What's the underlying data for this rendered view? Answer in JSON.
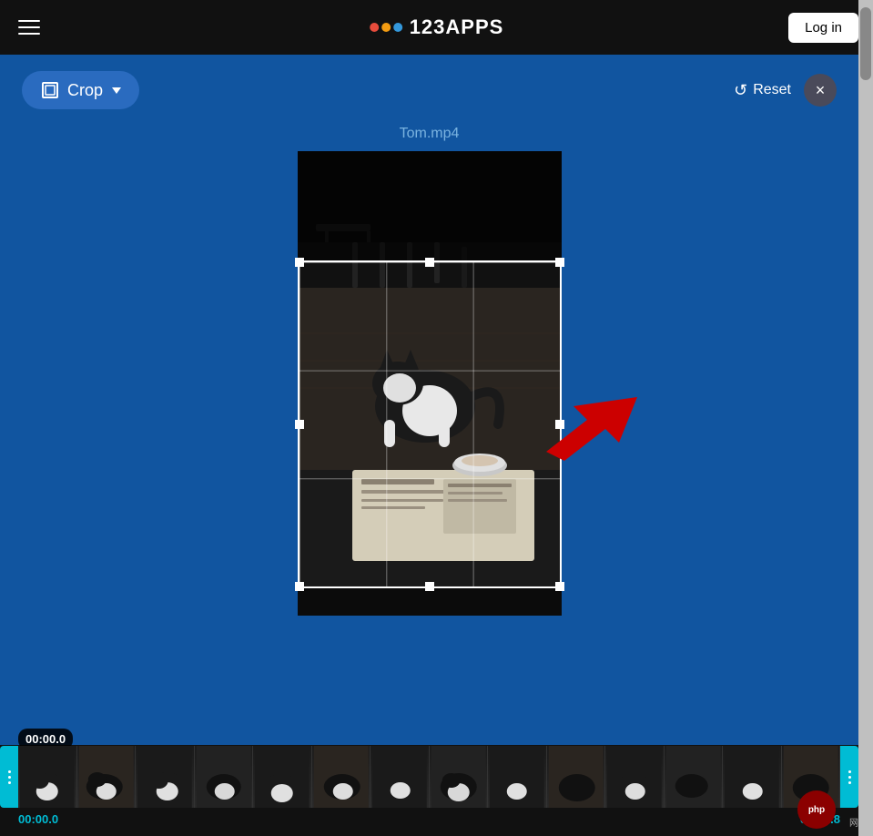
{
  "header": {
    "menu_label": "Menu",
    "logo_text": "123APPS",
    "login_label": "Log in"
  },
  "toolbar": {
    "crop_label": "Crop",
    "reset_label": "Reset",
    "close_label": "×"
  },
  "filename": "Tom.mp4",
  "timeline": {
    "start_time": "00:00.0",
    "end_time": "00:52.8",
    "tooltip_time": "00:00.0"
  },
  "colors": {
    "header_bg": "#111111",
    "main_bg": "#1155a0",
    "crop_btn_bg": "#2a6bbf",
    "timeline_bg": "#111111",
    "handle_color": "#00bcd4",
    "filename_color": "#7ab3e0"
  }
}
